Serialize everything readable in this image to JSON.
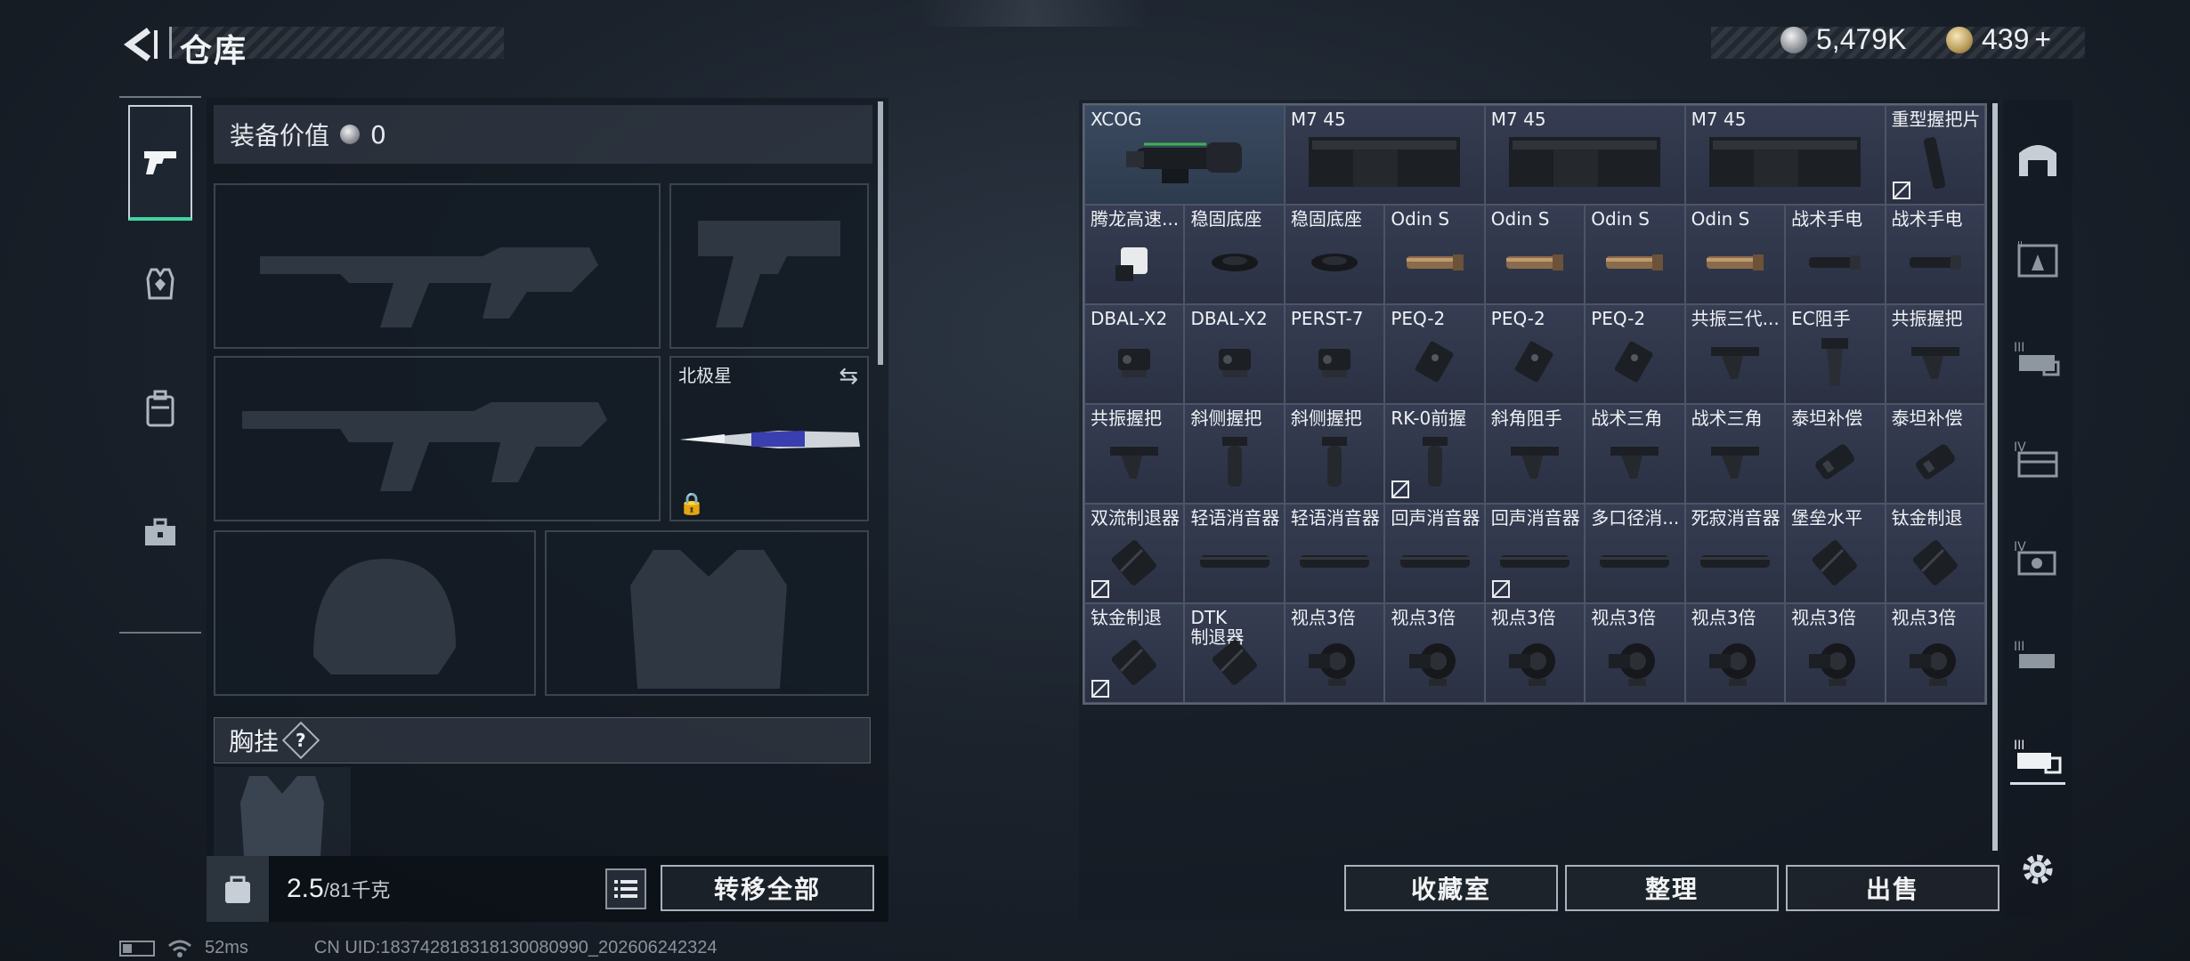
{
  "header": {
    "title": "仓库",
    "currency_silver": "5,479K",
    "currency_gold": "439",
    "plus": "+"
  },
  "loadout": {
    "value_label": "装备价值",
    "value": "0",
    "melee_name": "北极星",
    "chest_label": "胸挂",
    "chest_help": "?",
    "weight": "2.5",
    "weight_max": "/81",
    "weight_unit": "千克",
    "transfer_all": "转移全部"
  },
  "stash": {
    "items": [
      {
        "name": "XCOG",
        "wide": true,
        "icon": "scope-icon",
        "highlight": true
      },
      {
        "name": "M7 45",
        "wide": true,
        "icon": "magazine-icon"
      },
      {
        "name": "M7 45",
        "wide": true,
        "icon": "magazine-icon"
      },
      {
        "name": "M7 45",
        "wide": true,
        "icon": "magazine-icon"
      },
      {
        "name": "重型握把片",
        "icon": "grip-pad-icon",
        "marked": true
      },
      {
        "name": "腾龙高速...",
        "icon": "laser-icon"
      },
      {
        "name": "稳固底座",
        "icon": "mount-icon"
      },
      {
        "name": "稳固底座",
        "icon": "mount-icon"
      },
      {
        "name": "Odin S",
        "icon": "flashlight-icon"
      },
      {
        "name": "Odin S",
        "icon": "flashlight-icon"
      },
      {
        "name": "Odin S",
        "icon": "flashlight-icon"
      },
      {
        "name": "Odin S",
        "icon": "flashlight-icon"
      },
      {
        "name": "战术手电",
        "icon": "torch-icon"
      },
      {
        "name": "战术手电",
        "icon": "torch-icon"
      },
      {
        "name": "DBAL-X2",
        "icon": "laser-box-icon"
      },
      {
        "name": "DBAL-X2",
        "icon": "laser-box-icon"
      },
      {
        "name": "PERST-7",
        "icon": "laser-box-icon"
      },
      {
        "name": "PEQ-2",
        "icon": "peq-icon"
      },
      {
        "name": "PEQ-2",
        "icon": "peq-icon"
      },
      {
        "name": "PEQ-2",
        "icon": "peq-icon"
      },
      {
        "name": "共振三代...",
        "icon": "angled-grip-icon"
      },
      {
        "name": "EC阻手",
        "icon": "handstop-icon"
      },
      {
        "name": "共振握把",
        "icon": "angled-grip-icon"
      },
      {
        "name": "共振握把",
        "icon": "angled-grip-icon"
      },
      {
        "name": "斜侧握把",
        "icon": "vertical-grip-icon"
      },
      {
        "name": "斜侧握把",
        "icon": "vertical-grip-icon"
      },
      {
        "name": "RK-0前握",
        "icon": "vertical-grip-icon",
        "marked": true
      },
      {
        "name": "斜角阻手",
        "icon": "angled-grip-icon"
      },
      {
        "name": "战术三角",
        "icon": "angled-grip-icon"
      },
      {
        "name": "战术三角",
        "icon": "angled-grip-icon"
      },
      {
        "name": "泰坦补偿",
        "icon": "compensator-icon"
      },
      {
        "name": "泰坦补偿",
        "icon": "compensator-icon"
      },
      {
        "name": "双流制退器",
        "icon": "muzzle-brake-icon",
        "marked": true
      },
      {
        "name": "轻语消音器",
        "icon": "suppressor-icon"
      },
      {
        "name": "轻语消音器",
        "icon": "suppressor-icon"
      },
      {
        "name": "回声消音器",
        "icon": "suppressor-icon"
      },
      {
        "name": "回声消音器",
        "icon": "suppressor-icon",
        "marked": true
      },
      {
        "name": "多口径消...",
        "icon": "suppressor-icon"
      },
      {
        "name": "死寂消音器",
        "icon": "suppressor-icon"
      },
      {
        "name": "堡垒水平",
        "icon": "muzzle-brake-icon"
      },
      {
        "name": "钛金制退",
        "icon": "muzzle-brake-icon"
      },
      {
        "name": "钛金制退",
        "icon": "muzzle-brake-icon",
        "marked": true
      },
      {
        "name": "DTK\n制退器",
        "icon": "muzzle-brake-icon",
        "two": true
      },
      {
        "name": "视点3倍",
        "icon": "red-dot-icon"
      },
      {
        "name": "视点3倍",
        "icon": "red-dot-icon"
      },
      {
        "name": "视点3倍",
        "icon": "red-dot-icon"
      },
      {
        "name": "视点3倍",
        "icon": "red-dot-icon"
      },
      {
        "name": "视点3倍",
        "icon": "red-dot-icon"
      },
      {
        "name": "视点3倍",
        "icon": "red-dot-icon"
      },
      {
        "name": "视点3倍",
        "icon": "red-dot-icon"
      }
    ],
    "buttons": {
      "collection": "收藏室",
      "organize": "整理",
      "sell": "出售"
    }
  },
  "footer": {
    "ping": "52ms",
    "uid": "CN UID:183742818318130080990_202606242324"
  },
  "colors": {
    "accent_green": "#3fd5a0",
    "cell_bg": "#363d52",
    "panel_bg": "#1c232d"
  }
}
